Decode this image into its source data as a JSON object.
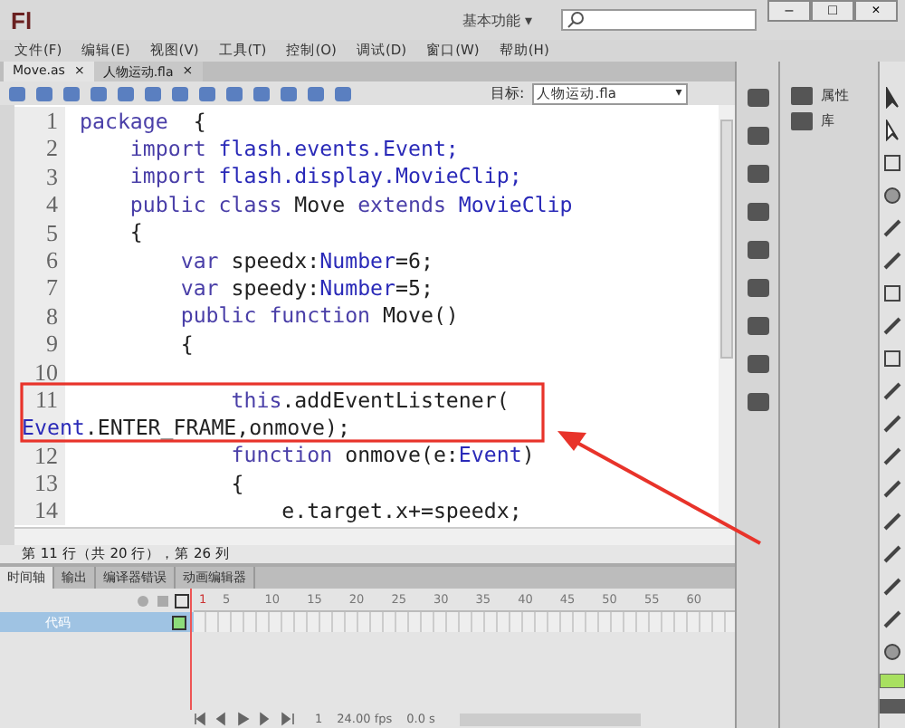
{
  "window": {
    "logo": "Fl",
    "workspace": "基本功能",
    "workspace_caret": "▾",
    "controls": [
      "–",
      "□",
      "×"
    ]
  },
  "menu": [
    "文件(F)",
    "编辑(E)",
    "视图(V)",
    "工具(T)",
    "控制(O)",
    "调试(D)",
    "窗口(W)",
    "帮助(H)"
  ],
  "doc_tabs": [
    {
      "label": "Move.as",
      "close": "×",
      "selected": true
    },
    {
      "label": "人物运动.fla",
      "close": "×",
      "selected": false
    }
  ],
  "target": {
    "label": "目标:",
    "value": "人物运动.fla",
    "caret": "▾"
  },
  "code": [
    {
      "num": "1",
      "tokens": [
        {
          "t": "package",
          "kind": "keyword"
        },
        {
          "t": "  {",
          "kind": "plain"
        }
      ]
    },
    {
      "num": "2",
      "tokens": [
        {
          "t": "    import",
          "kind": "keyword"
        },
        {
          "t": " flash.events.Event;",
          "kind": "type"
        }
      ]
    },
    {
      "num": "3",
      "tokens": [
        {
          "t": "    import",
          "kind": "keyword"
        },
        {
          "t": " flash.display.MovieClip;",
          "kind": "type"
        }
      ]
    },
    {
      "num": "4",
      "tokens": [
        {
          "t": "    public class",
          "kind": "keyword"
        },
        {
          "t": " Move ",
          "kind": "plain"
        },
        {
          "t": "extends",
          "kind": "keyword"
        },
        {
          "t": " MovieClip",
          "kind": "type"
        }
      ]
    },
    {
      "num": "5",
      "tokens": [
        {
          "t": "    {",
          "kind": "plain"
        }
      ]
    },
    {
      "num": "6",
      "tokens": [
        {
          "t": "        var",
          "kind": "keyword"
        },
        {
          "t": " speedx:",
          "kind": "plain"
        },
        {
          "t": "Number",
          "kind": "type"
        },
        {
          "t": "=6;",
          "kind": "plain"
        }
      ]
    },
    {
      "num": "7",
      "tokens": [
        {
          "t": "        var",
          "kind": "keyword"
        },
        {
          "t": " speedy:",
          "kind": "plain"
        },
        {
          "t": "Number",
          "kind": "type"
        },
        {
          "t": "=5;",
          "kind": "plain"
        }
      ]
    },
    {
      "num": "8",
      "tokens": [
        {
          "t": "        public function",
          "kind": "keyword"
        },
        {
          "t": " Move()",
          "kind": "plain"
        }
      ]
    },
    {
      "num": "9",
      "tokens": [
        {
          "t": "        {",
          "kind": "plain"
        }
      ]
    },
    {
      "num": "10"
    },
    {
      "num": "11",
      "tokens": [
        {
          "t": "            this",
          "kind": "keyword"
        },
        {
          "t": ".addEventListener(",
          "kind": "plain"
        }
      ],
      "wrap": [
        {
          "t": "Event",
          "kind": "type"
        },
        {
          "t": ".ENTER_FRAME,onmove);",
          "kind": "plain"
        }
      ]
    },
    {
      "num": "12",
      "tokens": [
        {
          "t": "            function",
          "kind": "keyword"
        },
        {
          "t": " onmove(e:",
          "kind": "plain"
        },
        {
          "t": "Event",
          "kind": "type"
        },
        {
          "t": ")",
          "kind": "plain"
        }
      ]
    },
    {
      "num": "13",
      "tokens": [
        {
          "t": "            {",
          "kind": "plain"
        }
      ]
    },
    {
      "num": "14",
      "tokens": [
        {
          "t": "                e.target.x+=speedx;",
          "kind": "plain"
        }
      ]
    }
  ],
  "status": "第 11 行（共 20 行），第 26 列",
  "timeline": {
    "tabs": [
      {
        "label": "时间轴",
        "selected": true
      },
      {
        "label": "输出",
        "selected": false
      },
      {
        "label": "编译器错误",
        "selected": false
      },
      {
        "label": "动画编辑器",
        "selected": false
      }
    ],
    "frames": [
      "1",
      "5",
      "10",
      "15",
      "20",
      "25",
      "30",
      "35",
      "40",
      "45",
      "50",
      "55",
      "60"
    ],
    "layers": [
      {
        "name": "代码",
        "selected": true
      }
    ],
    "frame": "1",
    "fps": "24.00 fps",
    "time": "0.0 s"
  },
  "panels": [
    {
      "label": "属性"
    },
    {
      "label": "库"
    }
  ]
}
